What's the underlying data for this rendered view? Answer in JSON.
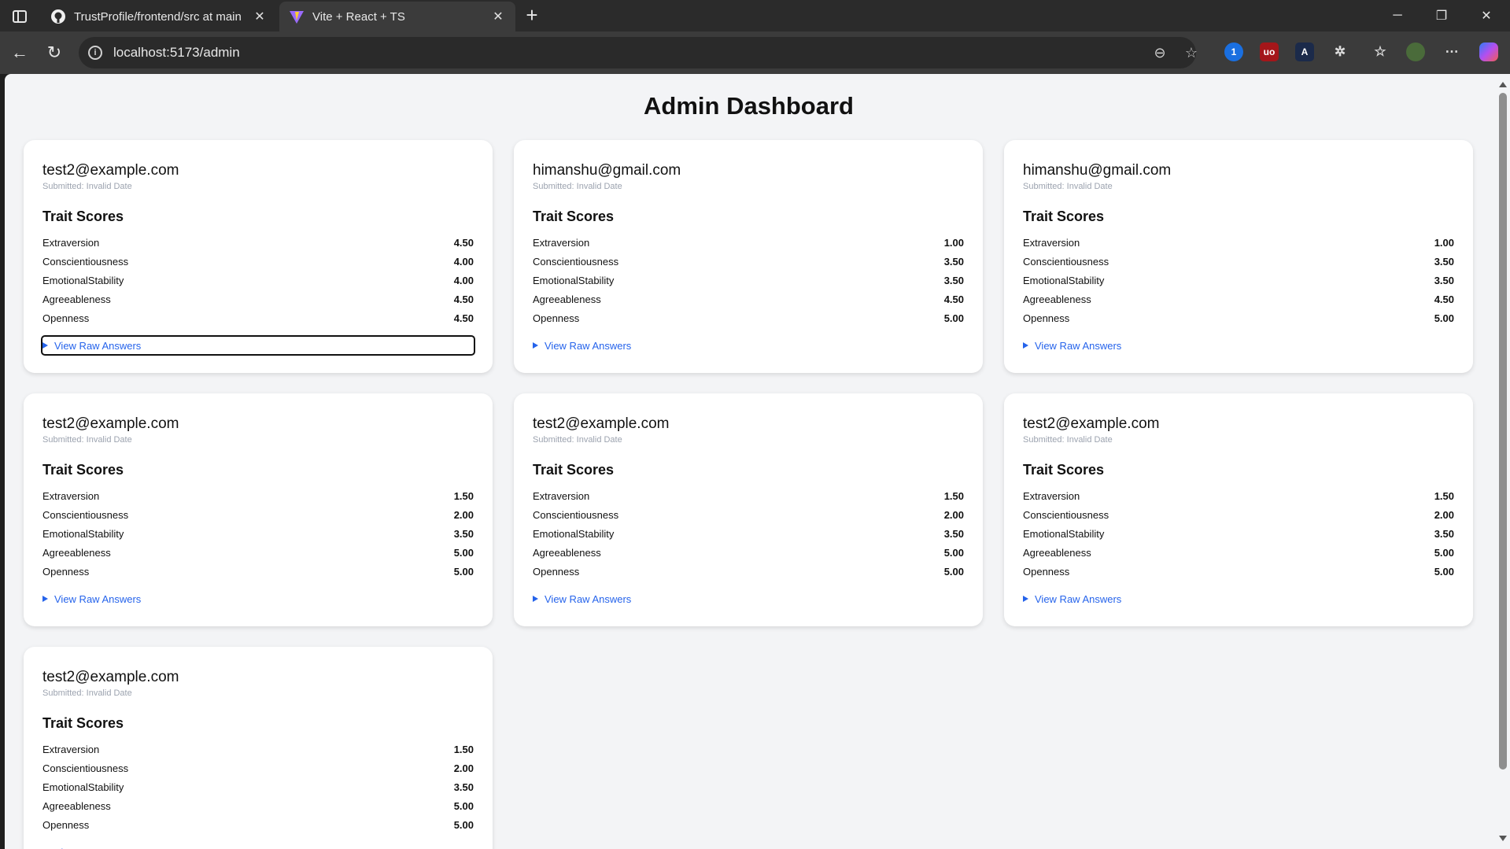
{
  "browser": {
    "tabs": [
      {
        "title": "TrustProfile/frontend/src at main",
        "active": false,
        "favicon": "github-icon"
      },
      {
        "title": "Vite + React + TS",
        "active": true,
        "favicon": "vite-icon"
      }
    ],
    "url": "localhost:5173/admin"
  },
  "page": {
    "title": "Admin Dashboard",
    "cards": [
      {
        "email": "test2@example.com",
        "submitted": "Submitted: Invalid Date",
        "section_title": "Trait Scores",
        "traits": [
          [
            "Extraversion",
            "4.50"
          ],
          [
            "Conscientiousness",
            "4.00"
          ],
          [
            "EmotionalStability",
            "4.00"
          ],
          [
            "Agreeableness",
            "4.50"
          ],
          [
            "Openness",
            "4.50"
          ]
        ],
        "raw_label": "View Raw Answers",
        "focused": true
      },
      {
        "email": "himanshu@gmail.com",
        "submitted": "Submitted: Invalid Date",
        "section_title": "Trait Scores",
        "traits": [
          [
            "Extraversion",
            "1.00"
          ],
          [
            "Conscientiousness",
            "3.50"
          ],
          [
            "EmotionalStability",
            "3.50"
          ],
          [
            "Agreeableness",
            "4.50"
          ],
          [
            "Openness",
            "5.00"
          ]
        ],
        "raw_label": "View Raw Answers",
        "focused": false
      },
      {
        "email": "himanshu@gmail.com",
        "submitted": "Submitted: Invalid Date",
        "section_title": "Trait Scores",
        "traits": [
          [
            "Extraversion",
            "1.00"
          ],
          [
            "Conscientiousness",
            "3.50"
          ],
          [
            "EmotionalStability",
            "3.50"
          ],
          [
            "Agreeableness",
            "4.50"
          ],
          [
            "Openness",
            "5.00"
          ]
        ],
        "raw_label": "View Raw Answers",
        "focused": false
      },
      {
        "email": "test2@example.com",
        "submitted": "Submitted: Invalid Date",
        "section_title": "Trait Scores",
        "traits": [
          [
            "Extraversion",
            "1.50"
          ],
          [
            "Conscientiousness",
            "2.00"
          ],
          [
            "EmotionalStability",
            "3.50"
          ],
          [
            "Agreeableness",
            "5.00"
          ],
          [
            "Openness",
            "5.00"
          ]
        ],
        "raw_label": "View Raw Answers",
        "focused": false
      },
      {
        "email": "test2@example.com",
        "submitted": "Submitted: Invalid Date",
        "section_title": "Trait Scores",
        "traits": [
          [
            "Extraversion",
            "1.50"
          ],
          [
            "Conscientiousness",
            "2.00"
          ],
          [
            "EmotionalStability",
            "3.50"
          ],
          [
            "Agreeableness",
            "5.00"
          ],
          [
            "Openness",
            "5.00"
          ]
        ],
        "raw_label": "View Raw Answers",
        "focused": false
      },
      {
        "email": "test2@example.com",
        "submitted": "Submitted: Invalid Date",
        "section_title": "Trait Scores",
        "traits": [
          [
            "Extraversion",
            "1.50"
          ],
          [
            "Conscientiousness",
            "2.00"
          ],
          [
            "EmotionalStability",
            "3.50"
          ],
          [
            "Agreeableness",
            "5.00"
          ],
          [
            "Openness",
            "5.00"
          ]
        ],
        "raw_label": "View Raw Answers",
        "focused": false
      },
      {
        "email": "test2@example.com",
        "submitted": "Submitted: Invalid Date",
        "section_title": "Trait Scores",
        "traits": [
          [
            "Extraversion",
            "1.50"
          ],
          [
            "Conscientiousness",
            "2.00"
          ],
          [
            "EmotionalStability",
            "3.50"
          ],
          [
            "Agreeableness",
            "5.00"
          ],
          [
            "Openness",
            "5.00"
          ]
        ],
        "raw_label": "View Raw Answers",
        "focused": false
      }
    ]
  },
  "colors": {
    "link": "#2563eb",
    "page_bg": "#f3f4f6",
    "card_bg": "#ffffff"
  }
}
